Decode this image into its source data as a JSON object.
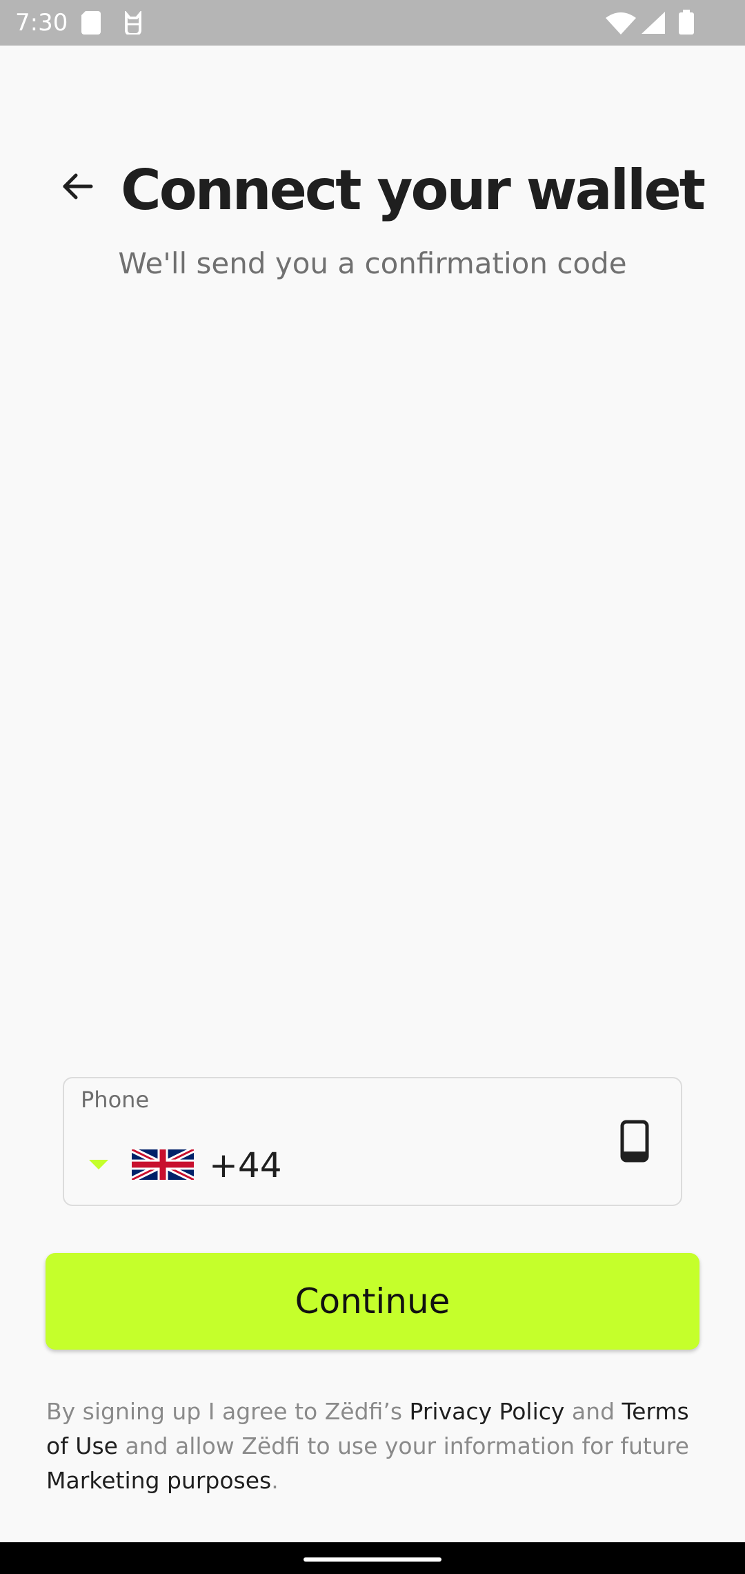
{
  "status_bar": {
    "time": "7:30",
    "icons": [
      "sd-card-icon",
      "cat-icon",
      "wifi-icon",
      "signal-icon",
      "battery-icon"
    ]
  },
  "header": {
    "back_icon": "arrow-left-icon",
    "title": "Connect your wallet",
    "subtitle": "We'll send you a confirmation code"
  },
  "phone_field": {
    "label": "Phone",
    "country_flag": "uk-flag-icon",
    "value": "+44",
    "trailing_icon": "smartphone-icon"
  },
  "continue_label": "Continue",
  "legal": {
    "part1": "By signing up I agree to Zëdfi’s ",
    "privacy_link": "Privacy Policy",
    "part2": " and ",
    "terms_link": "Terms of Use",
    "part3": " and allow Zëdfi to use your information for future ",
    "marketing_link": "Marketing purposes",
    "part4": "."
  },
  "colors": {
    "accent": "#c5ff2b",
    "background": "#f9f9f9",
    "title": "#1f1f1f",
    "subtitle": "#707070",
    "status_bar": "#b5b5b5"
  }
}
